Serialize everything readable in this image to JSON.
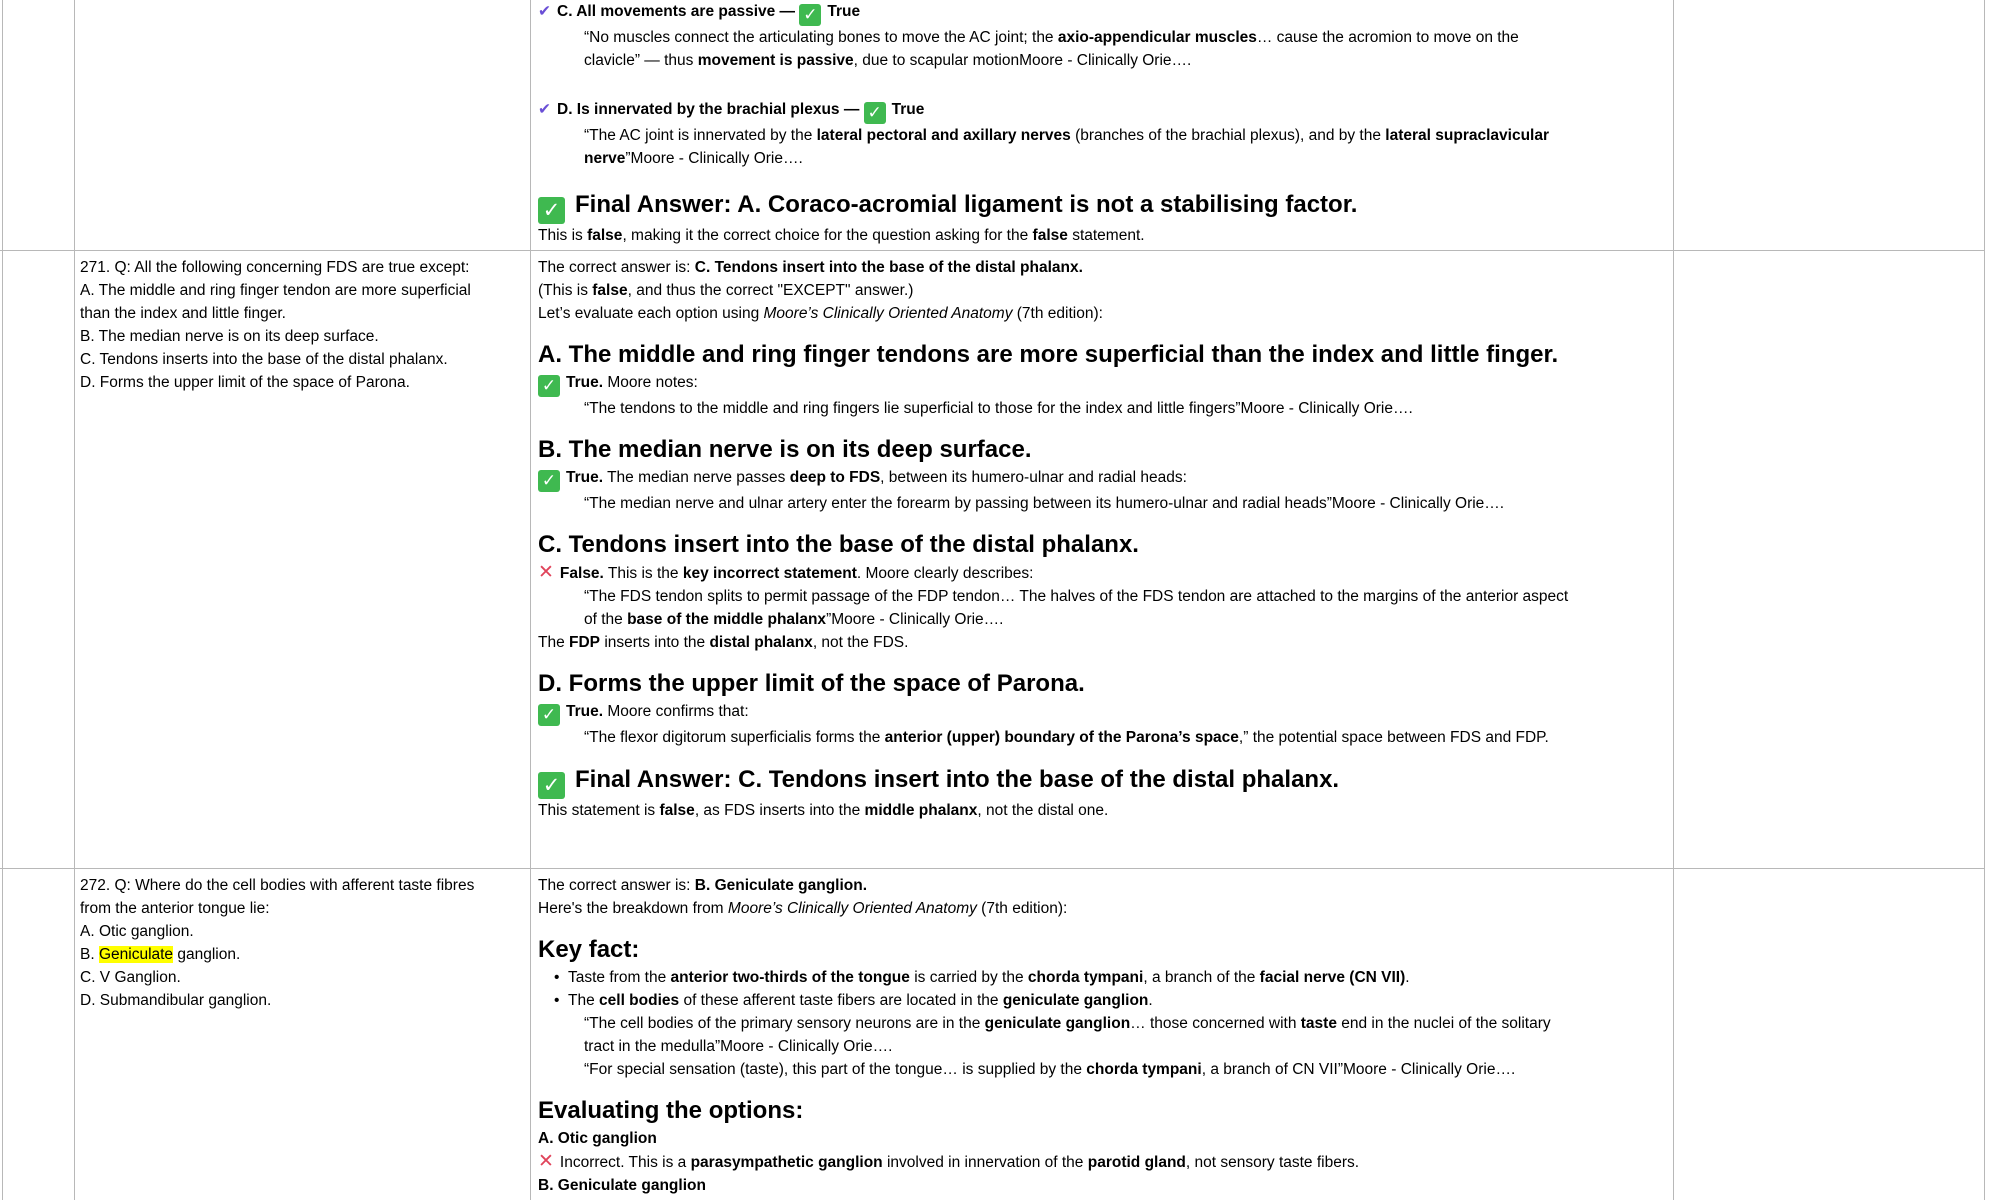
{
  "row_prev": {
    "opt_c_head": "C. All movements are passive —",
    "opt_c_verdict": "True",
    "opt_c_quote_1": "“No muscles connect the articulating bones to move the AC joint; the ",
    "opt_c_quote_b1": "axio-appendicular muscles",
    "opt_c_quote_2": "… cause the acromion to move on the",
    "opt_c_quote_3": "clavicle” — thus ",
    "opt_c_quote_b2": "movement is passive",
    "opt_c_quote_4": ", due to scapular motionMoore - Clinically Orie….",
    "opt_d_head": "D. Is innervated by the brachial plexus —",
    "opt_d_verdict": "True",
    "opt_d_quote_1": "“The AC joint is innervated by the ",
    "opt_d_quote_b1": "lateral pectoral and axillary nerves",
    "opt_d_quote_2": " (branches of the brachial plexus), and by the ",
    "opt_d_quote_b2": "lateral supraclavicular",
    "opt_d_quote_b3": "nerve",
    "opt_d_quote_3": "”Moore - Clinically Orie….",
    "final": "Final Answer: A. Coraco-acromial ligament is not a stabilising factor.",
    "final_note_1": "This is ",
    "final_note_b1": "false",
    "final_note_2": ", making it the correct choice for the question asking for the ",
    "final_note_b2": "false",
    "final_note_3": " statement."
  },
  "row271": {
    "question": [
      "271. Q: All the following concerning FDS are true except:",
      "A. The middle and ring finger tendon are more superficial",
      "than the index and little finger.",
      "B. The median nerve is on its deep surface.",
      "C. Tendons inserts into the base of the distal phalanx.",
      "D. Forms the upper limit of the space of Parona."
    ],
    "correct_prefix": "The correct answer is: ",
    "correct_answer": "C. Tendons insert into the base of the distal phalanx.",
    "except_1": "(This is ",
    "except_b": "false",
    "except_2": ", and thus the correct \"EXCEPT\" answer.)",
    "evaluate_1": "Let’s evaluate each option using ",
    "evaluate_book": "Moore’s Clinically Oriented Anatomy",
    "evaluate_2": " (7th edition):",
    "a_head": "A. The middle and ring finger tendons are more superficial than the index and little finger.",
    "a_verdict": "True.",
    "a_text": " Moore notes:",
    "a_quote": "“The tendons to the middle and ring fingers lie superficial to those for the index and little fingers”Moore - Clinically Orie….",
    "b_head": "B. The median nerve is on its deep surface.",
    "b_verdict": "True.",
    "b_text_1": " The median nerve passes ",
    "b_text_b": "deep to FDS",
    "b_text_2": ", between its humero-ulnar and radial heads:",
    "b_quote": "“The median nerve and ulnar artery enter the forearm by passing between its humero-ulnar and radial heads”Moore - Clinically Orie….",
    "c_head": "C. Tendons insert into the base of the distal phalanx.",
    "c_verdict": "False.",
    "c_text_1": " This is the ",
    "c_text_b": "key incorrect statement",
    "c_text_2": ". Moore clearly describes:",
    "c_quote_1": "“The FDS tendon splits to permit passage of the FDP tendon… The halves of the FDS tendon are attached to the margins of the anterior aspect",
    "c_quote_2": "of the ",
    "c_quote_b": "base of the middle phalanx",
    "c_quote_3": "”Moore - Clinically Orie….",
    "c_note_1": "The ",
    "c_note_b1": "FDP",
    "c_note_2": " inserts into the ",
    "c_note_b2": "distal phalanx",
    "c_note_3": ", not the FDS.",
    "d_head": "D. Forms the upper limit of the space of Parona.",
    "d_verdict": "True.",
    "d_text": " Moore confirms that:",
    "d_quote_1": "“The flexor digitorum superficialis forms the ",
    "d_quote_b": "anterior (upper) boundary of the Parona’s space",
    "d_quote_2": ",” the potential space between FDS and FDP.",
    "final": "Final Answer: C. Tendons insert into the base of the distal phalanx.",
    "final_note_1": "This statement is ",
    "final_note_b1": "false",
    "final_note_2": ", as FDS inserts into the ",
    "final_note_b2": "middle phalanx",
    "final_note_3": ", not the distal one."
  },
  "row272": {
    "question_1": "272. Q: Where do the cell bodies with afferent taste fibres",
    "question_2": "from the anterior tongue lie:",
    "option_a": "A. Otic ganglion.",
    "option_b_prefix": "B. ",
    "option_b_highlight": "Geniculate",
    "option_b_suffix": " ganglion.",
    "option_c": "C. V Ganglion.",
    "option_d": "D. Submandibular ganglion.",
    "correct_prefix": "The correct answer is: ",
    "correct_answer": "B. Geniculate ganglion.",
    "breakdown_1": "Here's the breakdown from ",
    "breakdown_book": "Moore’s Clinically Oriented Anatomy",
    "breakdown_2": " (7th edition):",
    "key_fact": "Key fact:",
    "bullet1_1": "Taste from the ",
    "bullet1_b1": "anterior two-thirds of the tongue",
    "bullet1_2": " is carried by the ",
    "bullet1_b2": "chorda tympani",
    "bullet1_3": ", a branch of the ",
    "bullet1_b3": "facial nerve (CN VII)",
    "bullet1_4": ".",
    "bullet2_1": "The ",
    "bullet2_b1": "cell bodies",
    "bullet2_2": " of these afferent taste fibers are located in the ",
    "bullet2_b2": "geniculate ganglion",
    "bullet2_3": ".",
    "quote1_1": "“The cell bodies of the primary sensory neurons are in the ",
    "quote1_b1": "geniculate ganglion",
    "quote1_2": "… those concerned with ",
    "quote1_b2": "taste",
    "quote1_3": " end in the nuclei of the solitary",
    "quote1_4": "tract in the medulla”Moore - Clinically Orie….",
    "quote2_1": "“For special sensation (taste), this part of the tongue… is supplied by the ",
    "quote2_b": "chorda tympani",
    "quote2_2": ", a branch of CN VII”Moore - Clinically Orie….",
    "evaluating": "Evaluating the options:",
    "eval_a_head": "A. Otic ganglion",
    "eval_a_1": "Incorrect. This is a ",
    "eval_a_b1": "parasympathetic ganglion",
    "eval_a_2": " involved in innervation of the ",
    "eval_a_b2": "parotid gland",
    "eval_a_3": ", not sensory taste fibers.",
    "eval_b_head": "B. Geniculate ganglion"
  }
}
